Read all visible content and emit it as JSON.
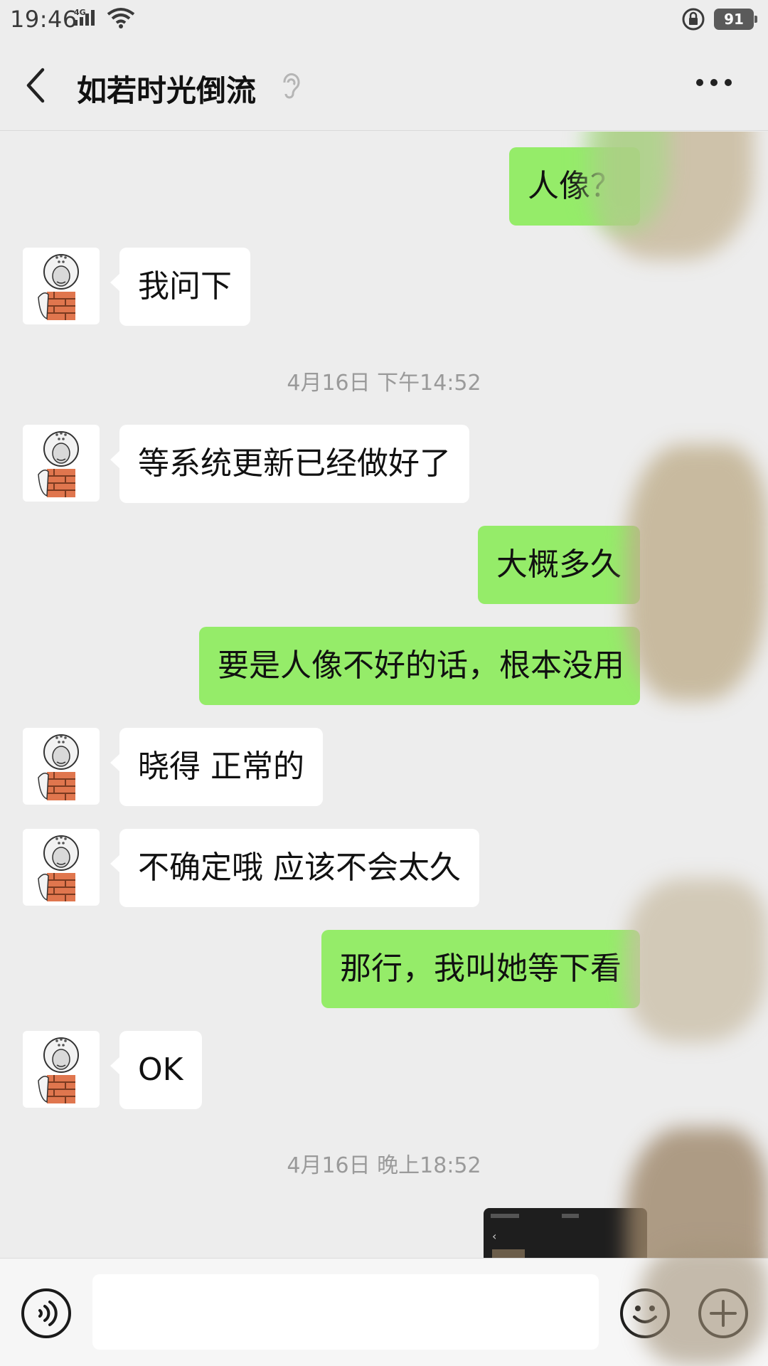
{
  "status_bar": {
    "time": "19:46",
    "network": "4G",
    "battery": "91"
  },
  "header": {
    "title": "如若时光倒流",
    "back_icon": "chevron-left-icon",
    "ear_icon": "ear-icon",
    "more_icon": "more-dots-icon"
  },
  "messages": [
    {
      "side": "out",
      "text": "人像？"
    },
    {
      "side": "in",
      "text": "我问下"
    },
    {
      "side": "time",
      "text": "4月16日 下午14:52"
    },
    {
      "side": "in",
      "text": "等系统更新已经做好了"
    },
    {
      "side": "out",
      "text": "大概多久"
    },
    {
      "side": "out",
      "text": "要是人像不好的话，根本没用"
    },
    {
      "side": "in",
      "text": "晓得 正常的"
    },
    {
      "side": "in",
      "text": "不确定哦 应该不会太久"
    },
    {
      "side": "out",
      "text": "那行，我叫她等下看"
    },
    {
      "side": "in",
      "text": "OK"
    },
    {
      "side": "time",
      "text": "4月16日 晚上18:52"
    },
    {
      "side": "out-image",
      "text": ""
    }
  ],
  "input_bar": {
    "placeholder": "",
    "voice_icon": "voice-icon",
    "emoji_icon": "emoji-icon",
    "plus_icon": "plus-icon"
  },
  "colors": {
    "background": "#ededed",
    "outgoing_bubble": "#95ec69",
    "incoming_bubble": "#ffffff",
    "timestamp_text": "#9a9a9a"
  }
}
